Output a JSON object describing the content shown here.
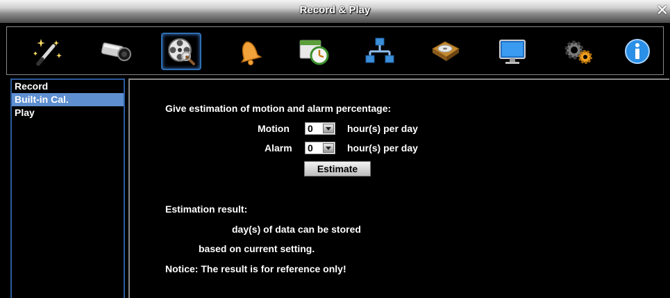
{
  "window": {
    "title": "Record & Play",
    "close_glyph": "✕"
  },
  "toolbar": {
    "icons": [
      {
        "name": "magic-wand-icon"
      },
      {
        "name": "camera-icon"
      },
      {
        "name": "film-reel-icon",
        "active": true
      },
      {
        "name": "alarm-bell-icon"
      },
      {
        "name": "schedule-clock-icon"
      },
      {
        "name": "network-icon"
      },
      {
        "name": "hard-disk-icon"
      },
      {
        "name": "monitor-icon"
      },
      {
        "name": "settings-gears-icon"
      },
      {
        "name": "info-icon"
      }
    ]
  },
  "sidebar": {
    "items": [
      {
        "label": "Record"
      },
      {
        "label": "Built-in Cal."
      },
      {
        "label": "Play"
      }
    ],
    "selected": "Built-in Cal."
  },
  "calc": {
    "heading": "Give estimation of motion and alarm percentage:",
    "motion": {
      "label": "Motion",
      "value": "0",
      "unit": "hour(s) per day"
    },
    "alarm": {
      "label": "Alarm",
      "value": "0",
      "unit": "hour(s) per day"
    },
    "estimate_label": "Estimate",
    "result_heading": "Estimation result:",
    "result_line1": "day(s) of data can be stored",
    "result_line2": "based on current setting.",
    "notice": "Notice: The result is for reference only!"
  },
  "colors": {
    "accent_blue": "#2b5c9e",
    "selected_item": "#5e8fd1",
    "background": "#000000"
  }
}
